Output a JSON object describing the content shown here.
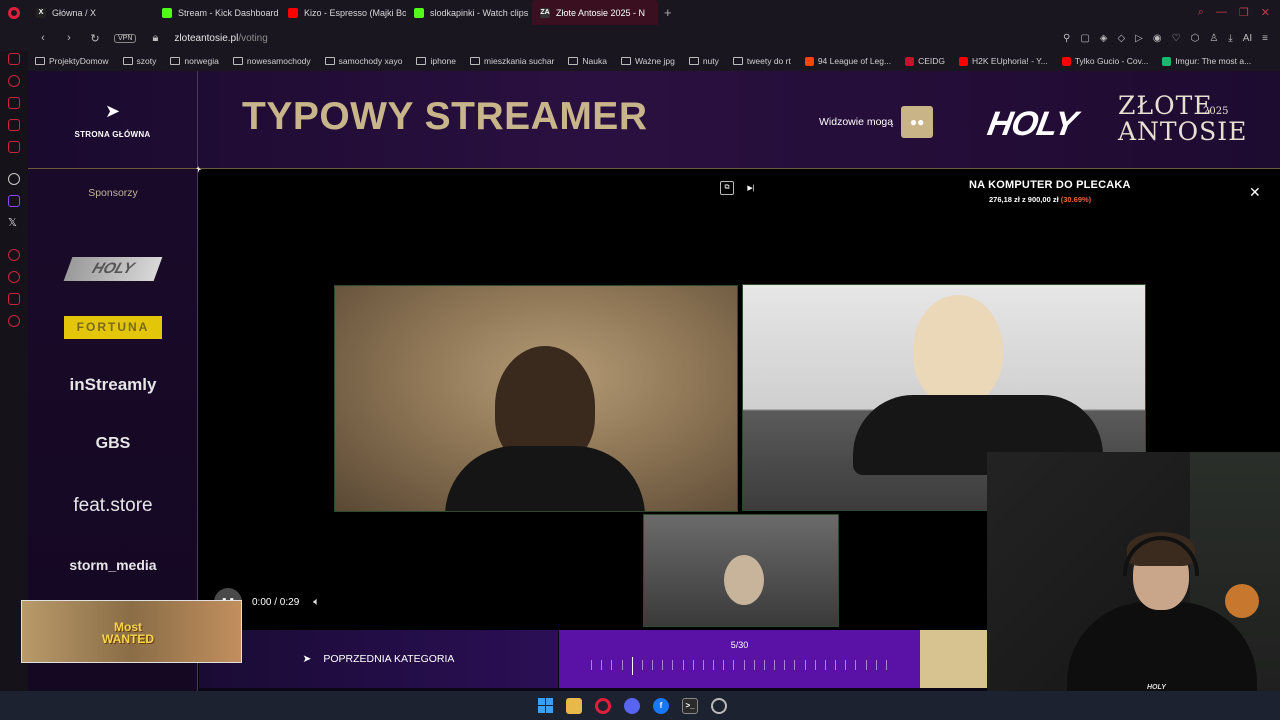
{
  "browser": {
    "tabs": [
      {
        "label": "Główna / X",
        "fav_color": "#222222",
        "fav_text": "X"
      },
      {
        "label": "Stream - Kick Dashboard",
        "fav_color": "#53fc18",
        "fav_text": ""
      },
      {
        "label": "Kizo - Espresso (Majki Bo",
        "fav_color": "#ff0000",
        "fav_text": ""
      },
      {
        "label": "slodkapinki - Watch clips",
        "fav_color": "#53fc18",
        "fav_text": ""
      },
      {
        "label": "Złote Antosie 2025 - N",
        "fav_color": "#333333",
        "fav_text": "ZA",
        "active": true
      }
    ],
    "new_tab": "+",
    "address": {
      "vpn": "VPN",
      "host": "zloteantosie.pl",
      "path": "/voting"
    },
    "ai_label": "AI",
    "bookmarks": [
      {
        "label": "ProjektyDomow",
        "kind": "folder"
      },
      {
        "label": "szoty",
        "kind": "folder"
      },
      {
        "label": "norwegia",
        "kind": "folder"
      },
      {
        "label": "nowesamochody",
        "kind": "folder"
      },
      {
        "label": "samochody xayo",
        "kind": "folder"
      },
      {
        "label": "iphone",
        "kind": "folder"
      },
      {
        "label": "mieszkania suchar",
        "kind": "folder"
      },
      {
        "label": "Nauka",
        "kind": "folder"
      },
      {
        "label": "Ważne jpg",
        "kind": "folder"
      },
      {
        "label": "nuty",
        "kind": "folder"
      },
      {
        "label": "tweety do rt",
        "kind": "folder"
      },
      {
        "label": "94 League of Leg...",
        "kind": "site",
        "color": "#ff4500"
      },
      {
        "label": "CEIDG",
        "kind": "site",
        "color": "#c8102e"
      },
      {
        "label": "H2K EUphoria! - Y...",
        "kind": "site",
        "color": "#ff0000"
      },
      {
        "label": "Tylko Gucio - Cov...",
        "kind": "site",
        "color": "#ff0000"
      },
      {
        "label": "Imgur: The most a...",
        "kind": "site",
        "color": "#1bb76e"
      }
    ]
  },
  "header": {
    "home_label": "STRONA GŁÓWNA",
    "title": "TYPOWY STREAMER",
    "viewers_label": "Widzowie mogą",
    "logo_holy": "HOLY",
    "logo_line1": "ZŁOTE",
    "logo_line2": "ANTOSIE",
    "logo_year": "2025"
  },
  "sponsors": {
    "title": "Sponsorzy",
    "items": [
      "HOLY",
      "FORTUNA",
      "inStreamly",
      "GBS",
      "feat.store",
      "storm_media"
    ]
  },
  "category": {
    "name": "NA KOMPUTER DO PLECAKA",
    "raised": "276,18 zł",
    "separator": "z",
    "goal": "900,00 zł",
    "percent": "(30.69%)"
  },
  "player": {
    "time": "0:00 / 0:29"
  },
  "navigation": {
    "prev_label": "POPRZEDNIA KATEGORIA",
    "progress_label": "5/30",
    "current": 5,
    "total": 30
  },
  "ad": {
    "line1": "Most",
    "line2": "WANTED"
  },
  "webcam": {
    "hoodie_logo": "HOLY"
  }
}
